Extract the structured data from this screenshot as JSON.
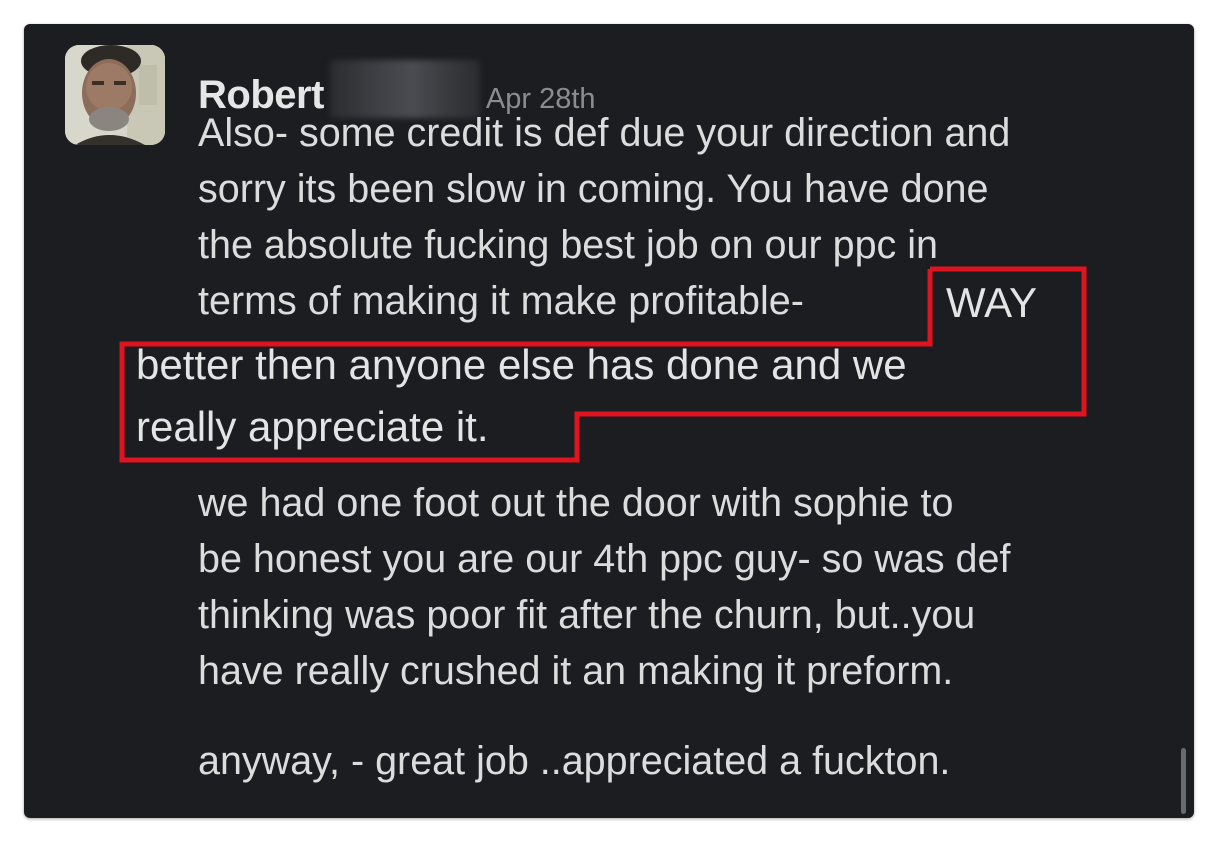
{
  "message": {
    "author": "Robert",
    "timestamp": "Apr 28th",
    "lines": [
      "Also- some credit is def due your direction and",
      "sorry its been slow in coming. You have done",
      "the absolute fucking best job on our ppc in",
      "terms of making it make  profitable-",
      "WAY",
      "better then anyone else has done and we",
      "really appreciate it.",
      "we had one foot out the door with sophie to",
      "be honest you are our 4th ppc guy- so was def",
      "thinking was poor fit after the churn, but..you",
      "have really crushed it an making it preform.",
      "anyway, - great job ..appreciated a fuckton."
    ]
  },
  "colors": {
    "background": "#1c1d21",
    "text": "#dcdcdc",
    "timestamp": "#8b8c90",
    "highlight_border": "#e0141e"
  },
  "icons": {
    "avatar": "user-avatar-photo"
  }
}
